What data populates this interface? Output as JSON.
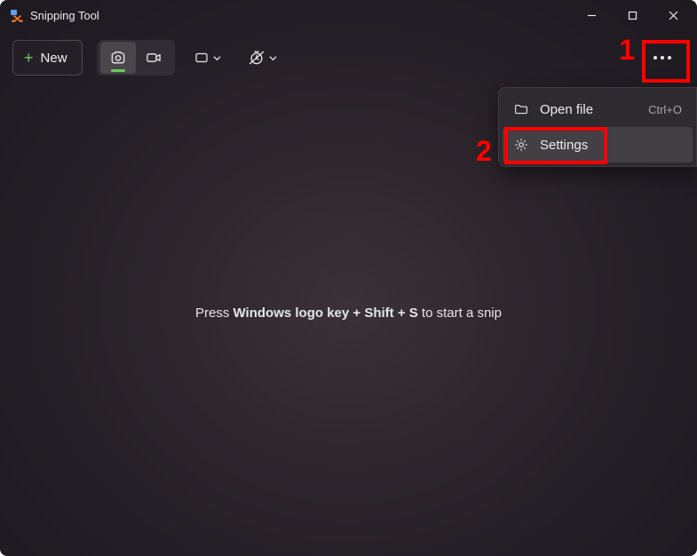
{
  "title": "Snipping Tool",
  "toolbar": {
    "new_label": "New"
  },
  "menu": {
    "open_file": {
      "label": "Open file",
      "shortcut": "Ctrl+O"
    },
    "settings": {
      "label": "Settings"
    }
  },
  "hint": {
    "prefix": "Press ",
    "keys": "Windows logo key + Shift + S",
    "suffix": " to start a snip"
  },
  "annotations": {
    "one": "1",
    "two": "2"
  }
}
